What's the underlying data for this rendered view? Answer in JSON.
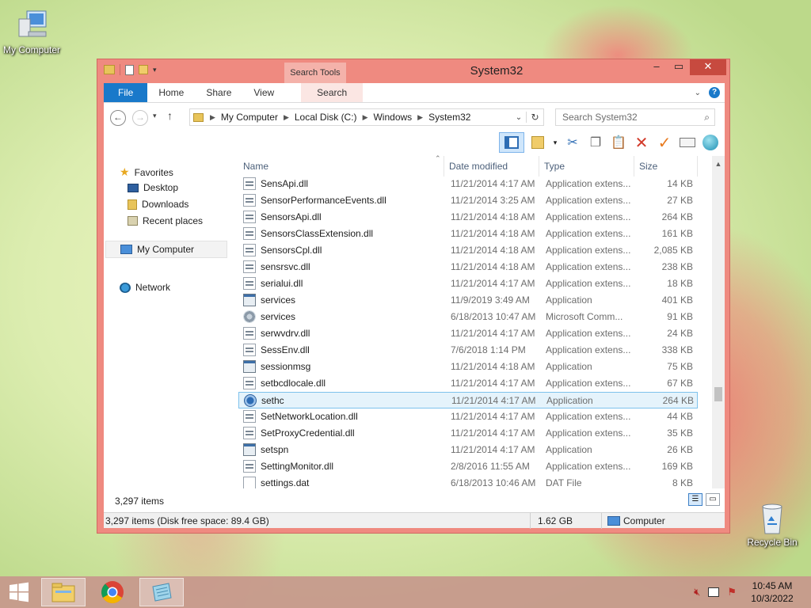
{
  "desktop": {
    "my_computer_label": "My Computer",
    "recycle_bin_label": "Recycle Bin"
  },
  "window": {
    "title": "System32",
    "context_tab_group": "Search Tools",
    "ribbon_tabs": [
      "File",
      "Home",
      "Share",
      "View",
      "Search"
    ],
    "controls": {
      "minimize": "–",
      "maximize": "▭",
      "close": "✕"
    }
  },
  "address_bar": {
    "crumbs": [
      "My Computer",
      "Local Disk (C:)",
      "Windows",
      "System32"
    ]
  },
  "search": {
    "placeholder": "Search System32"
  },
  "nav_pane": {
    "favorites": "Favorites",
    "desktop": "Desktop",
    "downloads": "Downloads",
    "recent_places": "Recent places",
    "my_computer": "My Computer",
    "network": "Network"
  },
  "columns": {
    "name": "Name",
    "date_modified": "Date modified",
    "type": "Type",
    "size": "Size"
  },
  "files": [
    {
      "name": "SensApi.dll",
      "date": "11/21/2014 4:17 AM",
      "type": "Application extens...",
      "size": "14 KB",
      "icon": "dll"
    },
    {
      "name": "SensorPerformanceEvents.dll",
      "date": "11/21/2014 3:25 AM",
      "type": "Application extens...",
      "size": "27 KB",
      "icon": "dll"
    },
    {
      "name": "SensorsApi.dll",
      "date": "11/21/2014 4:18 AM",
      "type": "Application extens...",
      "size": "264 KB",
      "icon": "dll"
    },
    {
      "name": "SensorsClassExtension.dll",
      "date": "11/21/2014 4:18 AM",
      "type": "Application extens...",
      "size": "161 KB",
      "icon": "dll"
    },
    {
      "name": "SensorsCpl.dll",
      "date": "11/21/2014 4:18 AM",
      "type": "Application extens...",
      "size": "2,085 KB",
      "icon": "dll"
    },
    {
      "name": "sensrsvc.dll",
      "date": "11/21/2014 4:18 AM",
      "type": "Application extens...",
      "size": "238 KB",
      "icon": "dll"
    },
    {
      "name": "serialui.dll",
      "date": "11/21/2014 4:17 AM",
      "type": "Application extens...",
      "size": "18 KB",
      "icon": "dll"
    },
    {
      "name": "services",
      "date": "11/9/2019 3:49 AM",
      "type": "Application",
      "size": "401 KB",
      "icon": "app"
    },
    {
      "name": "services",
      "date": "6/18/2013 10:47 AM",
      "type": "Microsoft Comm...",
      "size": "91 KB",
      "icon": "msc"
    },
    {
      "name": "serwvdrv.dll",
      "date": "11/21/2014 4:17 AM",
      "type": "Application extens...",
      "size": "24 KB",
      "icon": "dll"
    },
    {
      "name": "SessEnv.dll",
      "date": "7/6/2018 1:14 PM",
      "type": "Application extens...",
      "size": "338 KB",
      "icon": "dll"
    },
    {
      "name": "sessionmsg",
      "date": "11/21/2014 4:18 AM",
      "type": "Application",
      "size": "75 KB",
      "icon": "app"
    },
    {
      "name": "setbcdlocale.dll",
      "date": "11/21/2014 4:17 AM",
      "type": "Application extens...",
      "size": "67 KB",
      "icon": "dll"
    },
    {
      "name": "sethc",
      "date": "11/21/2014 4:17 AM",
      "type": "Application",
      "size": "264 KB",
      "icon": "sethc",
      "selected": true
    },
    {
      "name": "SetNetworkLocation.dll",
      "date": "11/21/2014 4:17 AM",
      "type": "Application extens...",
      "size": "44 KB",
      "icon": "dll"
    },
    {
      "name": "SetProxyCredential.dll",
      "date": "11/21/2014 4:17 AM",
      "type": "Application extens...",
      "size": "35 KB",
      "icon": "dll"
    },
    {
      "name": "setspn",
      "date": "11/21/2014 4:17 AM",
      "type": "Application",
      "size": "26 KB",
      "icon": "app"
    },
    {
      "name": "SettingMonitor.dll",
      "date": "2/8/2016 11:55 AM",
      "type": "Application extens...",
      "size": "169 KB",
      "icon": "dll"
    },
    {
      "name": "settings.dat",
      "date": "6/18/2013 10:46 AM",
      "type": "DAT File",
      "size": "8 KB",
      "icon": "dat"
    }
  ],
  "status": {
    "item_count": "3,297 items",
    "details_summary": "3,297 items (Disk free space: 89.4 GB)",
    "details_size": "1.62 GB",
    "details_location": "Computer"
  },
  "taskbar": {
    "time": "10:45 AM",
    "date": "10/3/2022"
  },
  "colors": {
    "window_frame": "#ef8a80",
    "file_tab": "#1979ca",
    "selection": "#e5f3fb"
  }
}
